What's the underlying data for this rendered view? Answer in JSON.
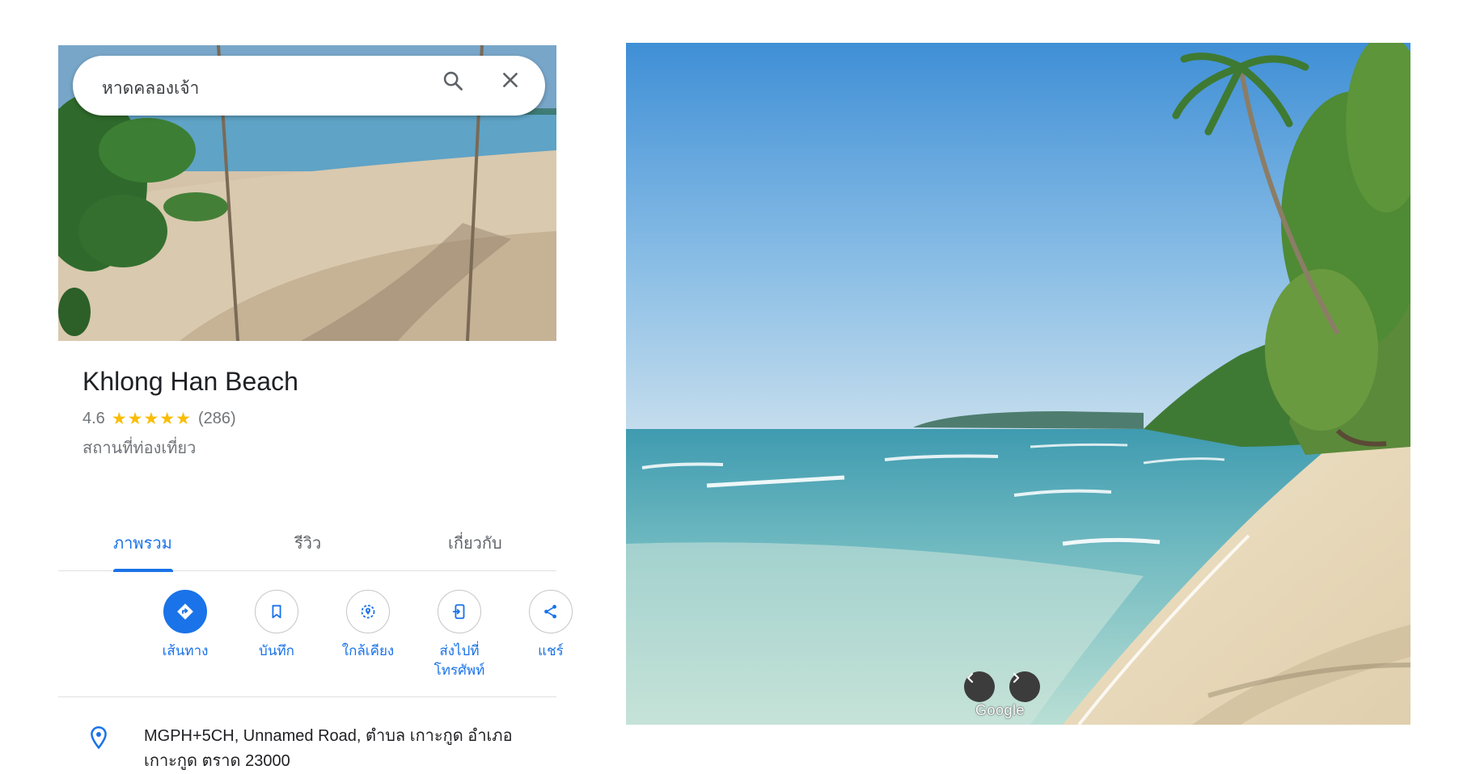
{
  "search": {
    "query": "หาดคลองเจ้า"
  },
  "place": {
    "name": "Khlong Han Beach",
    "rating": "4.6",
    "stars": "★★★★★",
    "review_count": "(286)",
    "category": "สถานที่ท่องเที่ยว"
  },
  "tabs": [
    {
      "label": "ภาพรวม",
      "active": true
    },
    {
      "label": "รีวิว",
      "active": false
    },
    {
      "label": "เกี่ยวกับ",
      "active": false
    }
  ],
  "actions": [
    {
      "label": "เส้นทาง",
      "icon": "directions-icon"
    },
    {
      "label": "บันทึก",
      "icon": "bookmark-icon"
    },
    {
      "label": "ใกล้เคียง",
      "icon": "nearby-icon"
    },
    {
      "label_line1": "ส่งไปที่",
      "label_line2": "โทรศัพท์",
      "icon": "send-to-phone-icon"
    },
    {
      "label": "แชร์",
      "icon": "share-icon"
    }
  ],
  "address": {
    "line1": "MGPH+5CH, Unnamed Road, ตำบล เกาะกูด อำเภอ",
    "line2": "เกาะกูด ตราด 23000"
  },
  "photo": {
    "watermark": "Google"
  },
  "colors": {
    "accent": "#1a73e8",
    "star": "#fbbc04",
    "muted": "#70757a"
  }
}
